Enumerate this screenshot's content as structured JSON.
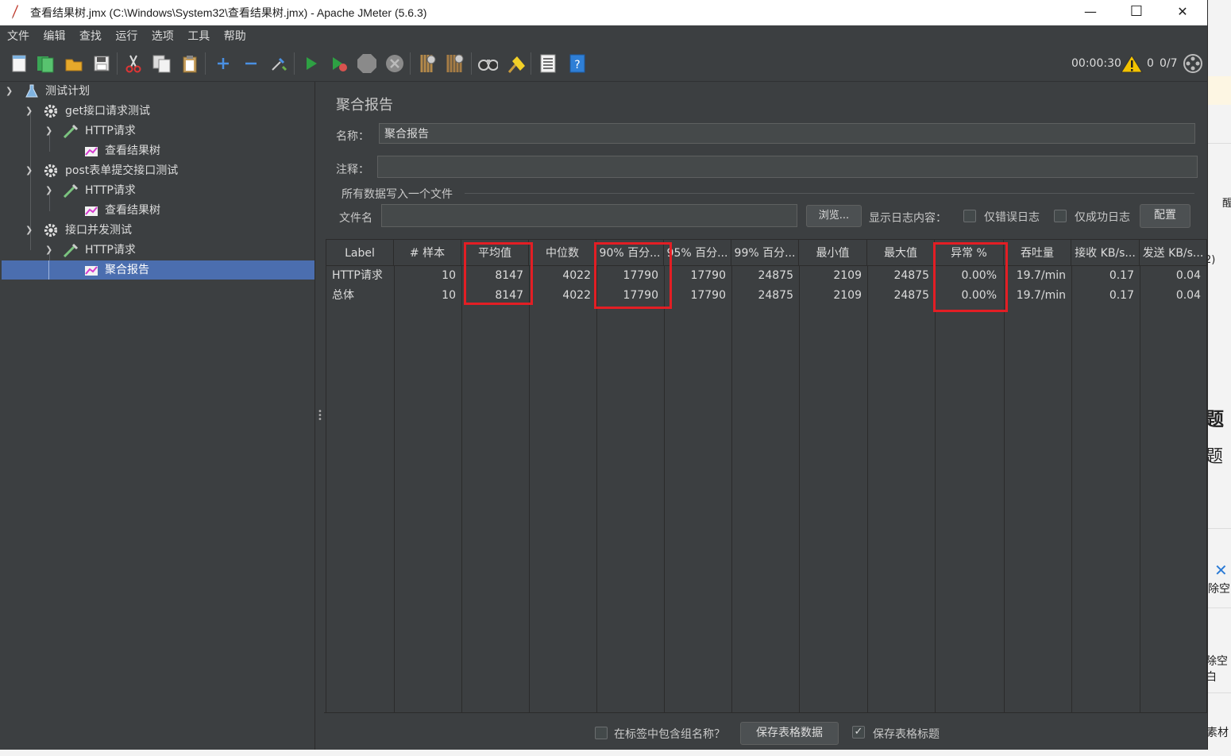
{
  "window": {
    "title": "查看结果树.jmx (C:\\Windows\\System32\\查看结果树.jmx) - Apache JMeter (5.6.3)",
    "minimize": "—",
    "maximize": "☐",
    "close": "✕"
  },
  "menu": [
    "文件",
    "编辑",
    "查找",
    "运行",
    "选项",
    "工具",
    "帮助"
  ],
  "toolbar": {
    "timer": "00:00:30",
    "warnings": "0",
    "threads": "0/7"
  },
  "tree": [
    {
      "label": "测试计划",
      "icon": "flask-icon"
    },
    {
      "label": "get接口请求测试",
      "icon": "gear-icon"
    },
    {
      "label": "HTTP请求",
      "icon": "pipette-icon"
    },
    {
      "label": "查看结果树",
      "icon": "chart-icon"
    },
    {
      "label": "post表单提交接口测试",
      "icon": "gear-icon"
    },
    {
      "label": "HTTP请求",
      "icon": "pipette-icon"
    },
    {
      "label": "查看结果树",
      "icon": "chart-icon"
    },
    {
      "label": "接口并发测试",
      "icon": "gear-icon"
    },
    {
      "label": "HTTP请求",
      "icon": "pipette-icon"
    },
    {
      "label": "聚合报告",
      "icon": "chart-icon"
    }
  ],
  "panel": {
    "title": "聚合报告",
    "name_label": "名称：",
    "name_value": "聚合报告",
    "comment_label": "注释：",
    "comment_value": "",
    "file_section": "所有数据写入一个文件",
    "filename_label": "文件名",
    "filename_value": "",
    "browse": "浏览...",
    "log_label": "显示日志内容：",
    "errors_only": "仅错误日志",
    "success_only": "仅成功日志",
    "configure": "配置"
  },
  "table": {
    "headers": [
      "Label",
      "# 样本",
      "平均值",
      "中位数",
      "90% 百分...",
      "95% 百分...",
      "99% 百分...",
      "最小值",
      "最大值",
      "异常 %",
      "吞吐量",
      "接收 KB/s...",
      "发送 KB/s..."
    ],
    "rows": [
      [
        "HTTP请求",
        "10",
        "8147",
        "4022",
        "17790",
        "17790",
        "24875",
        "2109",
        "24875",
        "0.00%",
        "19.7/min",
        "0.17",
        "0.04"
      ],
      [
        "总体",
        "10",
        "8147",
        "4022",
        "17790",
        "17790",
        "24875",
        "2109",
        "24875",
        "0.00%",
        "19.7/min",
        "0.17",
        "0.04"
      ]
    ]
  },
  "bottom": {
    "include_group": "在标签中包含组名称？",
    "save_data": "保存表格数据",
    "save_header": "保存表格标题",
    "include_group_checked": false,
    "save_header_checked": true
  },
  "background": {
    "t1": "题",
    "t2": "题",
    "t3": "除空",
    "t4": "除空白",
    "t5": "素材",
    "t6": "2)",
    "t7": "醒"
  }
}
